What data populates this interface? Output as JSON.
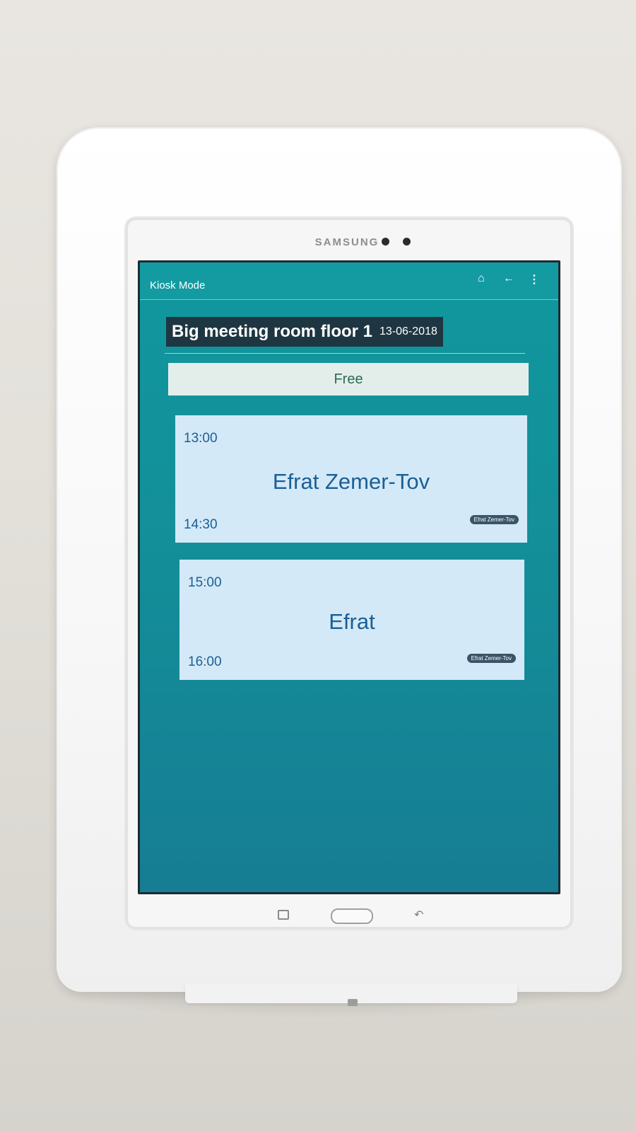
{
  "device": {
    "brand": "SAMSUNG"
  },
  "app": {
    "title": "Kiosk Mode"
  },
  "room": {
    "name": "Big meeting room floor 1",
    "date": "13-06-2018",
    "status": "Free"
  },
  "meetings": [
    {
      "start": "13:00",
      "end": "14:30",
      "title": "Efrat Zemer-Tov",
      "organizer": "Efrat Zemer-Tov"
    },
    {
      "start": "15:00",
      "end": "16:00",
      "title": "Efrat",
      "organizer": "Efrat Zemer-Tov"
    }
  ],
  "icons": {
    "home": "home-icon",
    "back": "back-arrow-icon",
    "more": "more-vertical-icon",
    "recent_apps": "recent-apps-icon",
    "android_back": "return-icon"
  },
  "colors": {
    "screen_bg": "#11979e",
    "room_header_bg": "#1e3642",
    "card_bg": "#d4e9f7",
    "card_text": "#1a5f96",
    "status_bg": "#e3eeea"
  }
}
